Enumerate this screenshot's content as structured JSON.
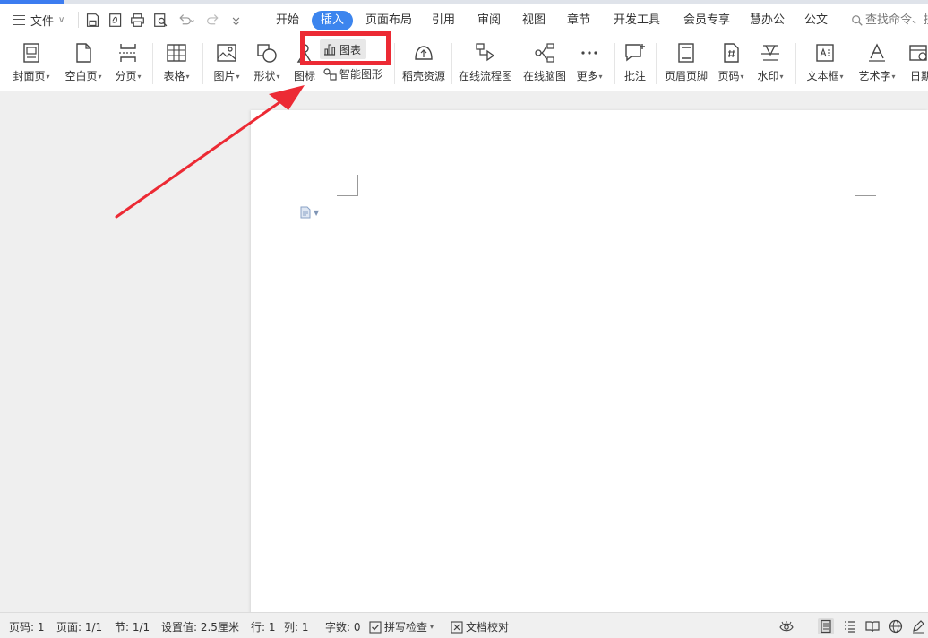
{
  "menu": {
    "file_label": "文件",
    "tabs": [
      "开始",
      "插入",
      "页面布局",
      "引用",
      "审阅",
      "视图",
      "章节",
      "开发工具",
      "会员专享",
      "慧办公",
      "公文"
    ],
    "active_tab": "插入",
    "search_text": "查找命令、搜"
  },
  "quick_access": [
    "save-icon",
    "export-pdf-icon",
    "print-icon",
    "print-preview-icon",
    "undo-icon",
    "redo-icon",
    "customize-icon"
  ],
  "ribbon": {
    "cover_page": "封面页",
    "blank_page": "空白页",
    "page_break": "分页",
    "table": "表格",
    "picture": "图片",
    "shape": "形状",
    "icon": "图标",
    "chart": "图表",
    "smart_graphic": "智能图形",
    "docer_resources": "稻壳资源",
    "online_flowchart": "在线流程图",
    "online_mindmap": "在线脑图",
    "more": "更多",
    "comment": "批注",
    "header_footer": "页眉页脚",
    "page_number": "页码",
    "watermark": "水印",
    "text_box": "文本框",
    "word_art": "艺术字",
    "date": "日期"
  },
  "status": {
    "page_number": "页码: 1",
    "pages": "页面: 1/1",
    "section": "节: 1/1",
    "setting": "设置值: 2.5厘米",
    "row": "行: 1",
    "column": "列: 1",
    "word_count": "字数: 0",
    "spell_check": "拼写检查",
    "doc_proofread": "文档校对"
  },
  "colors": {
    "accent": "#3c85ee",
    "annotation": "#ec2a34",
    "page": "#ffffff",
    "workspace": "#efefef"
  }
}
